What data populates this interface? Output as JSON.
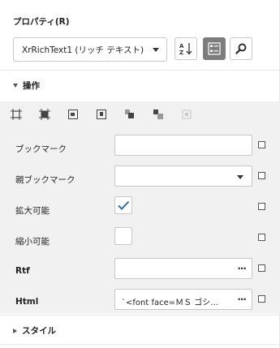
{
  "panel": {
    "title": "プロパティ(R)"
  },
  "toolbar": {
    "selector_value": "XrRichText1 (リッチ テキスト)",
    "sort_icon": "sort-az-icon",
    "categorized_icon": "categorized-icon",
    "search_icon": "search-icon",
    "active_color": "#7d7d7d"
  },
  "sections": {
    "operations": "操作",
    "style": "スタイル"
  },
  "align_icons": [
    "align-to-grid-icon",
    "size-to-grid-icon",
    "center-horizontally-icon",
    "center-vertically-icon",
    "bring-to-front-icon",
    "send-to-back-icon",
    "disabled-icon"
  ],
  "properties": {
    "bookmark": {
      "label": "ブックマーク",
      "value": ""
    },
    "parent_bookmark": {
      "label": "親ブックマーク",
      "value": ""
    },
    "can_grow": {
      "label": "拡大可能",
      "checked": true
    },
    "can_shrink": {
      "label": "縮小可能",
      "checked": false
    },
    "rtf": {
      "label": "Rtf",
      "value": "",
      "button": "···"
    },
    "html": {
      "label": "Html",
      "value": "`<font face=ＭＳ ゴシ…",
      "button": "···"
    }
  },
  "colors": {
    "checkmark": "#2d6ea8",
    "section_bg": "#f1f1f1"
  }
}
